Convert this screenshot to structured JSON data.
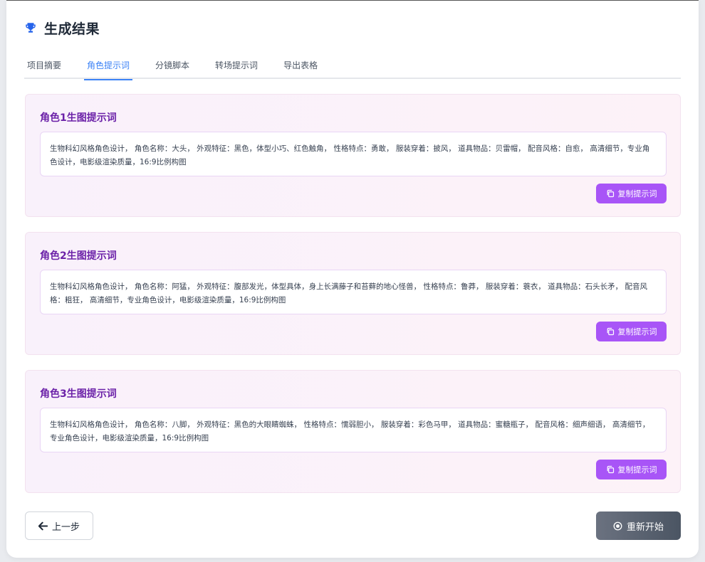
{
  "header": {
    "title": "生成结果",
    "icon": "trophy-icon"
  },
  "tabs": [
    {
      "label": "项目摘要",
      "active": false
    },
    {
      "label": "角色提示词",
      "active": true
    },
    {
      "label": "分镜脚本",
      "active": false
    },
    {
      "label": "转场提示词",
      "active": false
    },
    {
      "label": "导出表格",
      "active": false
    }
  ],
  "prompts": [
    {
      "title": "角色1生图提示词",
      "text": "生物科幻风格角色设计， 角色名称：大头， 外观特征：黑色，体型小巧、红色触角， 性格特点：勇敢， 服装穿着：披风， 道具物品：贝雷帽， 配音风格：自愈， 高清细节，专业角色设计，电影级渲染质量，16:9比例构图",
      "copy_label": "复制提示词"
    },
    {
      "title": "角色2生图提示词",
      "text": "生物科幻风格角色设计， 角色名称：阿猛， 外观特征：腹部发光，体型具体，身上长满藤子和苔藓的地心怪兽， 性格特点：鲁莽， 服装穿着：蓑衣， 道具物品：石头长矛， 配音风格：粗狂， 高清细节，专业角色设计，电影级渲染质量，16:9比例构图",
      "copy_label": "复制提示词"
    },
    {
      "title": "角色3生图提示词",
      "text": "生物科幻风格角色设计， 角色名称：八脚， 外观特征：黑色的大眼睛蜘蛛， 性格特点：懦弱胆小， 服装穿着：彩色马甲， 道具物品：蜜糖瓶子， 配音风格：细声细语， 高清细节，专业角色设计，电影级渲染质量，16:9比例构图",
      "copy_label": "复制提示词"
    }
  ],
  "footer": {
    "prev_label": "上一步",
    "restart_label": "重新开始"
  },
  "colors": {
    "accent": "#3b82f6",
    "purple": "#a855f7",
    "title_purple": "#6b21a8"
  }
}
